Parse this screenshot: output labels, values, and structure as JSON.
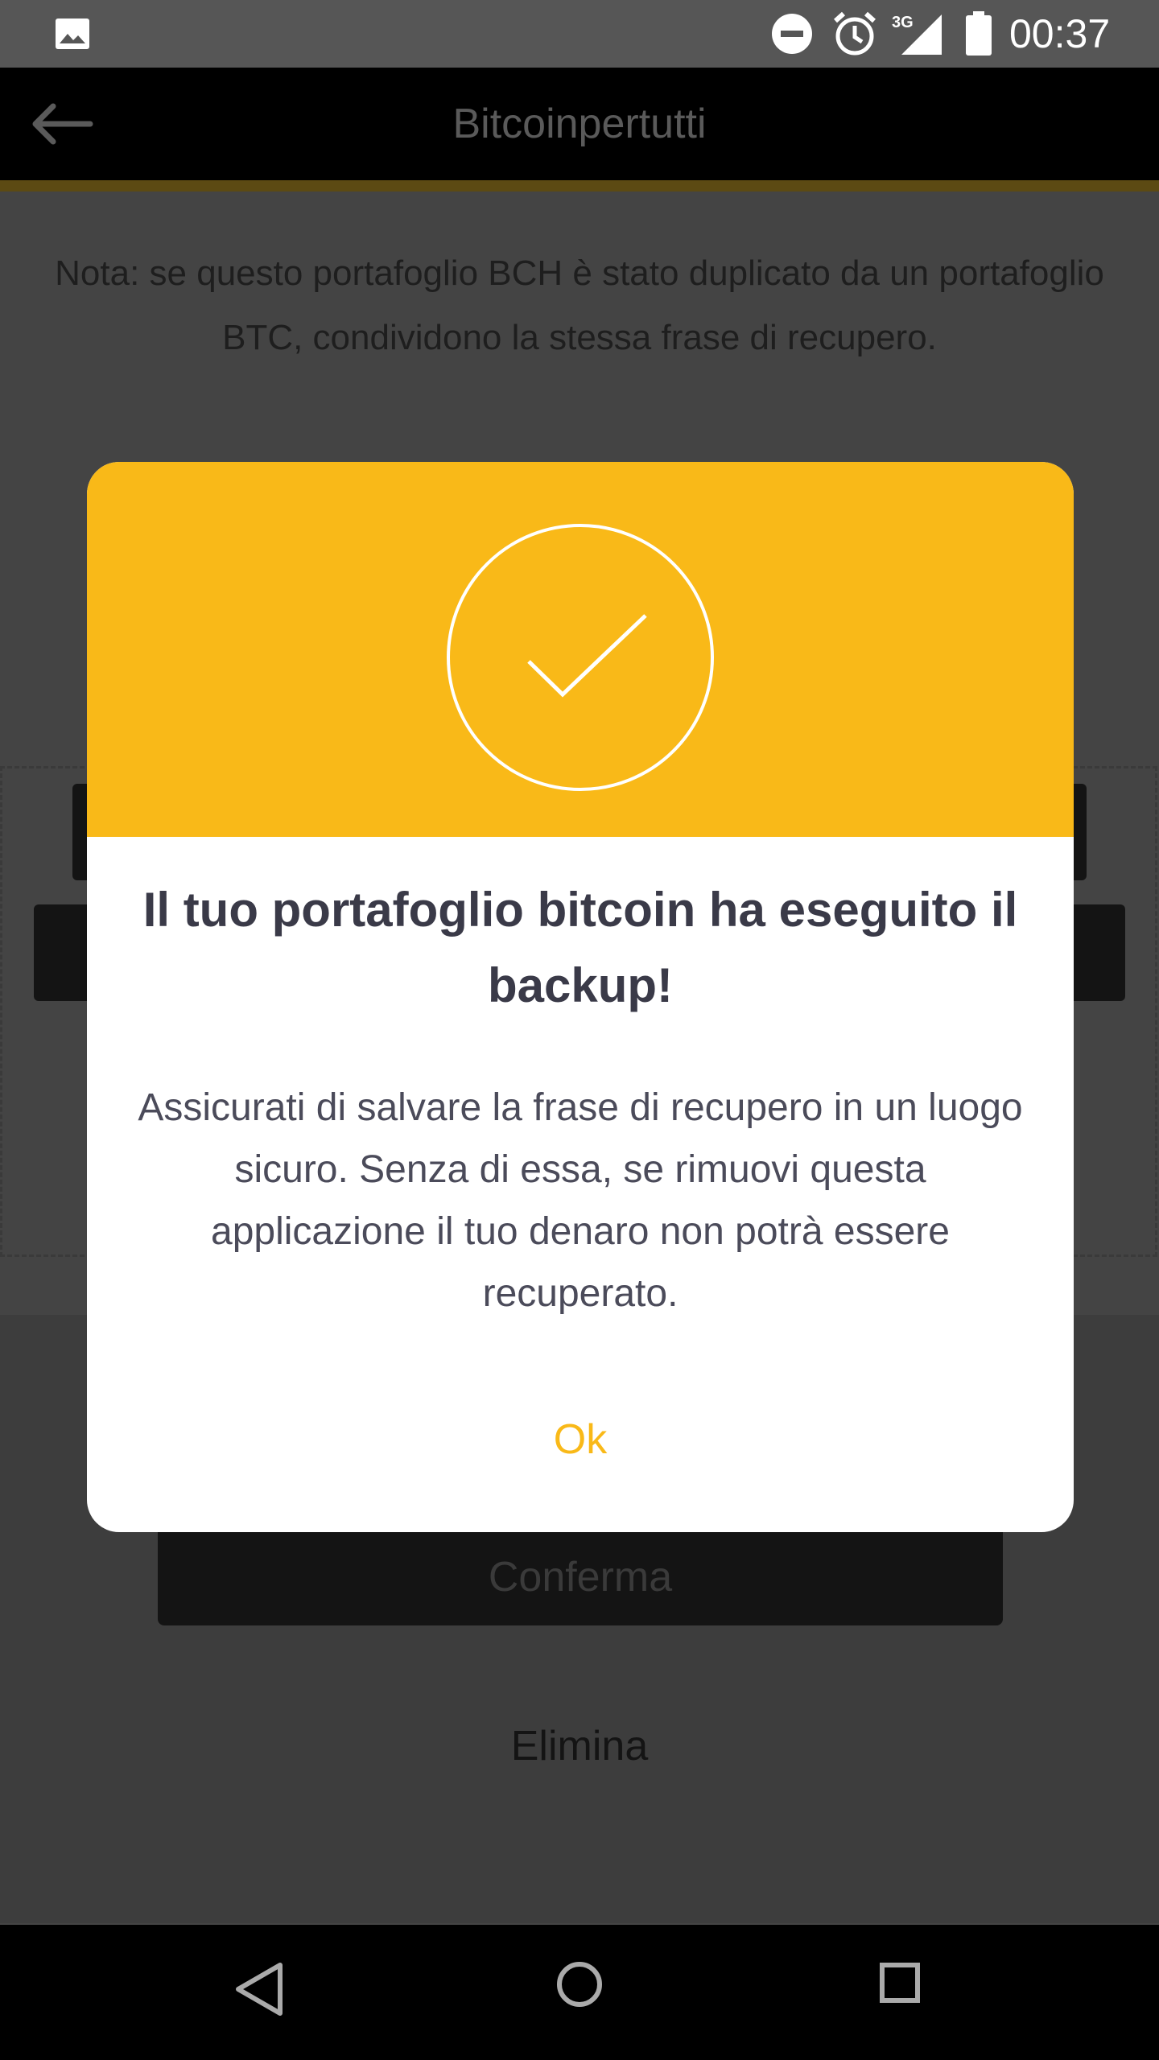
{
  "status_bar": {
    "time": "00:37",
    "network_label": "3G",
    "icons": [
      "image-icon",
      "do-not-disturb-icon",
      "alarm-icon",
      "signal-icon",
      "battery-icon"
    ]
  },
  "app_bar": {
    "title": "Bitcoinpertutti",
    "back_icon": "arrow-left-icon"
  },
  "note": "Nota: se questo portafoglio BCH è stato duplicato da un portafoglio BTC, condividono la stessa frase di recupero.",
  "actions": {
    "confirm_label": "Conferma",
    "delete_label": "Elimina"
  },
  "dialog": {
    "icon": "checkmark-circle-icon",
    "title": "Il tuo portafoglio bitcoin ha eseguito il backup!",
    "message": "Assicurati di salvare la frase di recupero in un luogo sicuro. Senza di essa, se rimuovi questa applicazione il tuo denaro non potrà essere recuperato.",
    "ok_label": "Ok"
  },
  "colors": {
    "accent": "#f9b918",
    "dialog_title": "#3a3a48",
    "dialog_text": "#4b4b5a"
  },
  "nav_bar": {
    "icons": [
      "nav-back-icon",
      "nav-home-icon",
      "nav-recents-icon"
    ]
  }
}
